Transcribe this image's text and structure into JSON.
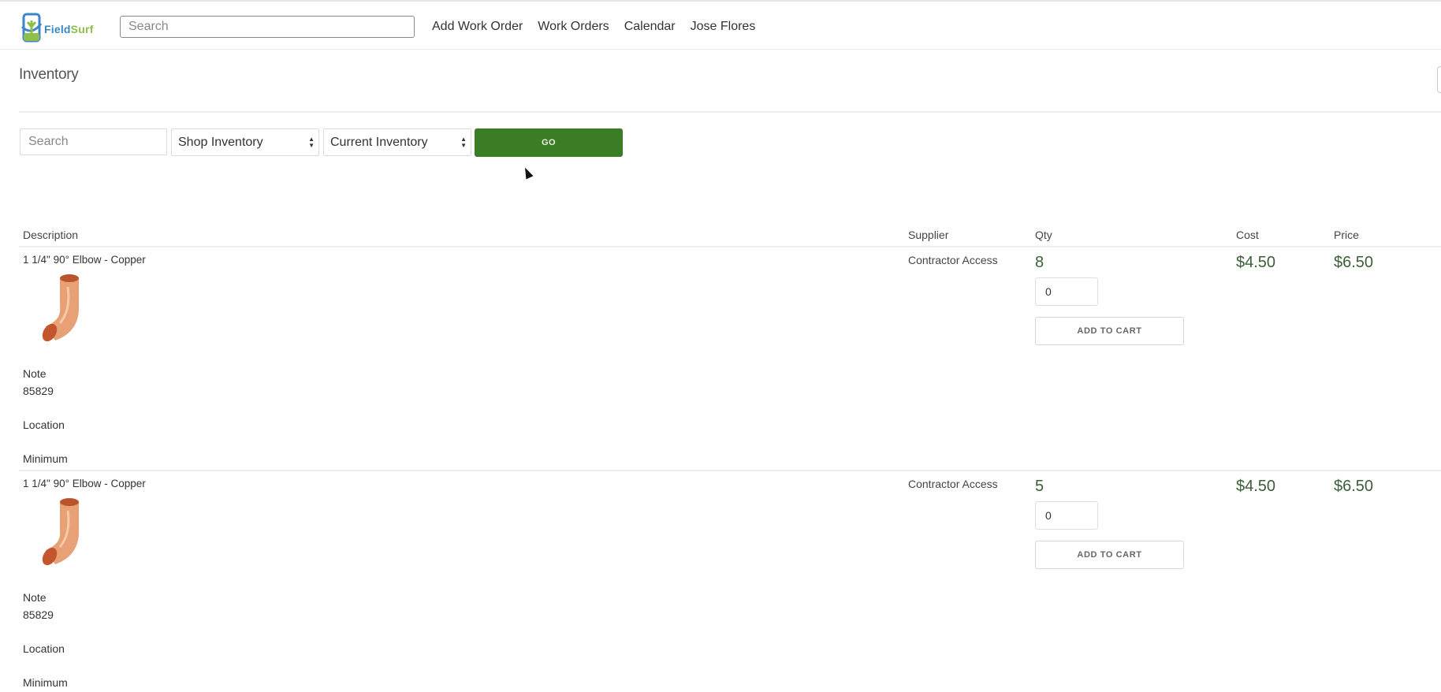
{
  "navbar": {
    "logo_text_1": "Field",
    "logo_text_2": "Surf",
    "search_placeholder": "Search",
    "links": [
      "Add Work Order",
      "Work Orders",
      "Calendar",
      "Jose Flores"
    ]
  },
  "page": {
    "title": "Inventory"
  },
  "filters": {
    "search_placeholder": "Search",
    "location_select": "Shop Inventory",
    "inventory_select": "Current Inventory",
    "go_label": "GO"
  },
  "table": {
    "headers": {
      "description": "Description",
      "supplier": "Supplier",
      "qty": "Qty",
      "cost": "Cost",
      "price": "Price"
    },
    "rows": [
      {
        "description": "1 1/4\" 90° Elbow - Copper",
        "note_label": "Note",
        "note": "85829",
        "location_label": "Location",
        "minimum_label": "Minimum",
        "supplier": "Contractor Access",
        "qty": "8",
        "qty_input": "0",
        "add_to_cart": "ADD TO CART",
        "cost": "$4.50",
        "price": "$6.50"
      },
      {
        "description": "1 1/4\" 90° Elbow - Copper",
        "note_label": "Note",
        "note": "85829",
        "location_label": "Location",
        "minimum_label": "Minimum",
        "supplier": "Contractor Access",
        "qty": "5",
        "qty_input": "0",
        "add_to_cart": "ADD TO CART",
        "cost": "$4.50",
        "price": "$6.50"
      }
    ]
  },
  "colors": {
    "accent_green": "#3a7d25",
    "value_green": "#3c5e38",
    "logo_blue": "#3b86c6",
    "logo_green": "#8cc04b"
  }
}
